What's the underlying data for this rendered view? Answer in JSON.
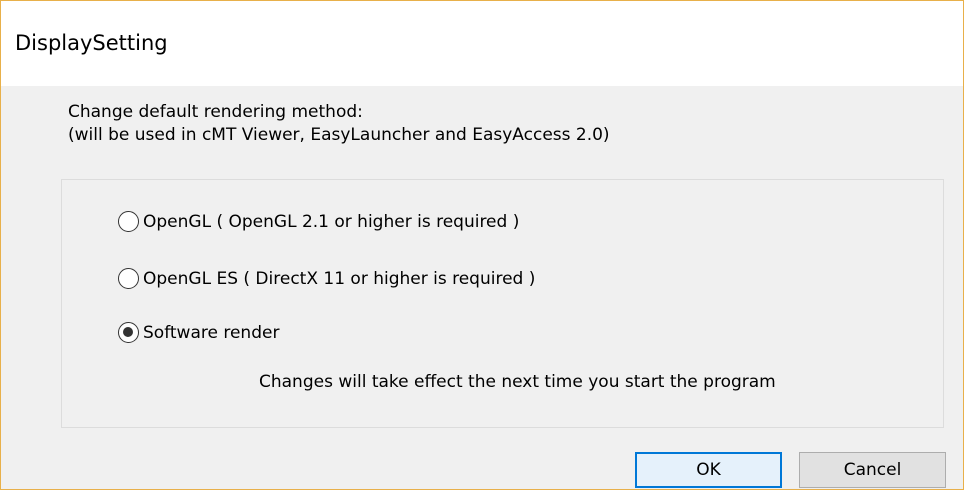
{
  "window": {
    "title": "DisplaySetting"
  },
  "description": {
    "line1": "Change default rendering method:",
    "line2": " (will be used in cMT Viewer, EasyLauncher and EasyAccess 2.0)"
  },
  "options": [
    {
      "label": "OpenGL ( OpenGL 2.1 or higher is required )",
      "checked": false
    },
    {
      "label": "OpenGL ES ( DirectX 11 or higher is required )",
      "checked": false
    },
    {
      "label": "Software render",
      "checked": true
    }
  ],
  "notice": "Changes will take effect the next time you start the program",
  "buttons": {
    "ok_label": "OK",
    "cancel_label": "Cancel"
  },
  "colors": {
    "window_border": "#e8b04a",
    "default_button_border": "#0078d7",
    "default_button_bg": "#e5f1fb"
  }
}
